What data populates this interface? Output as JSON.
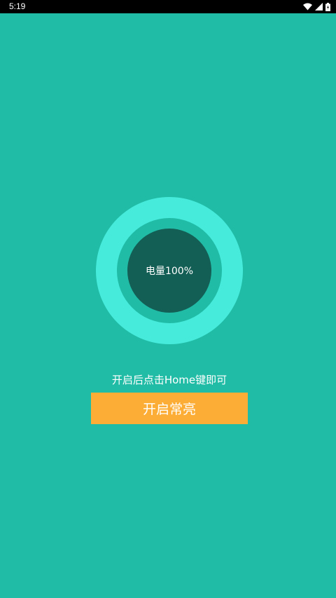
{
  "status_bar": {
    "time": "5:19",
    "icons": [
      "wifi-icon",
      "signal-icon",
      "battery-icon"
    ]
  },
  "battery": {
    "label": "电量100%",
    "level_percent": 100
  },
  "hint": {
    "text": "开启后点击Home键即可"
  },
  "button": {
    "label": "开启常亮"
  },
  "colors": {
    "background": "#20BCA6",
    "ring_outer": "#46EBDC",
    "ring_inner": "#135E55",
    "button": "#FBAD35"
  }
}
